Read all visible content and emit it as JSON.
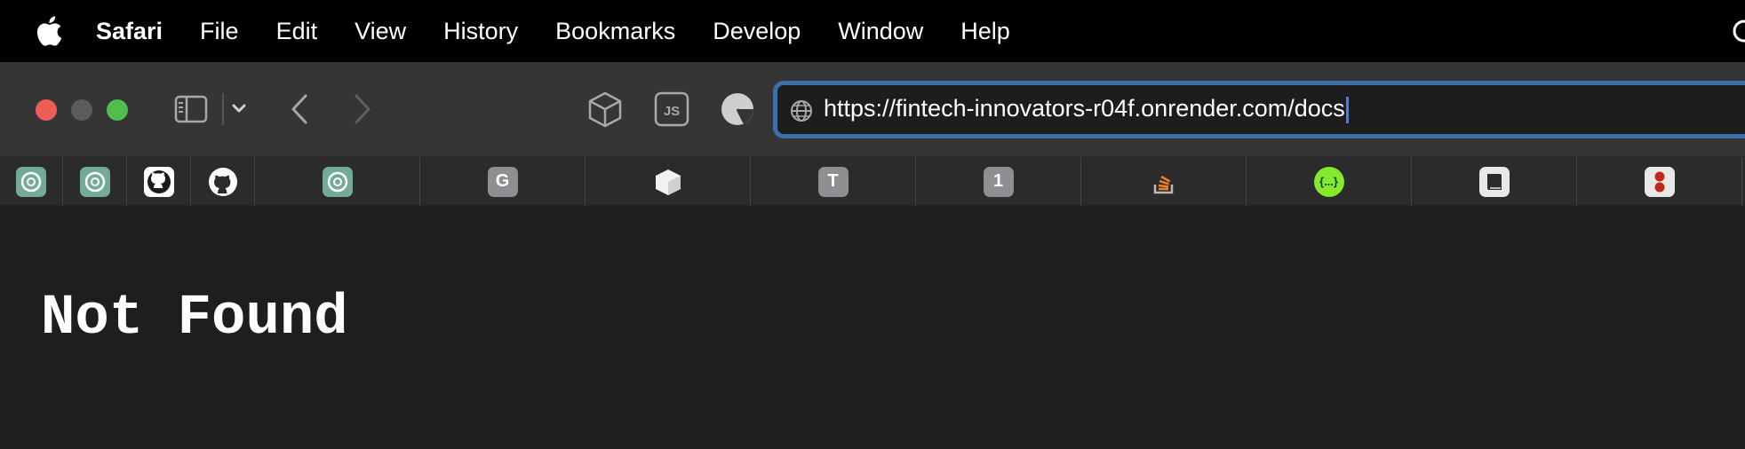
{
  "menubar": {
    "apple_icon": "apple-icon",
    "items": [
      {
        "label": "Safari"
      },
      {
        "label": "File"
      },
      {
        "label": "Edit"
      },
      {
        "label": "View"
      },
      {
        "label": "History"
      },
      {
        "label": "Bookmarks"
      },
      {
        "label": "Develop"
      },
      {
        "label": "Window"
      },
      {
        "label": "Help"
      }
    ]
  },
  "toolbar": {
    "traffic_lights": {
      "close": "#ee5d56",
      "minimize": "#5c5c5c",
      "zoom": "#4fbe4e"
    },
    "icons": [
      "sidebar-icon",
      "chevron-down-icon",
      "back-icon",
      "forward-icon",
      "cube-extension-icon",
      "js-extension-icon",
      "pie-extension-icon"
    ],
    "address": {
      "url": "https://fintech-innovators-r04f.onrender.com/docs",
      "icon": "globe-icon"
    }
  },
  "favorites": [
    {
      "icon": "chatgpt-icon",
      "label": ""
    },
    {
      "icon": "chatgpt-icon",
      "label": ""
    },
    {
      "icon": "github-icon",
      "label": ""
    },
    {
      "icon": "github-icon",
      "label": ""
    },
    {
      "icon": "chatgpt-icon",
      "label": ""
    },
    {
      "icon": "letter-g-icon",
      "label": "G"
    },
    {
      "icon": "white-cube-icon",
      "label": ""
    },
    {
      "icon": "letter-t-icon",
      "label": "T"
    },
    {
      "icon": "number-1-icon",
      "label": "1"
    },
    {
      "icon": "stackoverflow-icon",
      "label": ""
    },
    {
      "icon": "swagger-icon",
      "label": "{...}"
    },
    {
      "icon": "book-icon",
      "label": ""
    },
    {
      "icon": "red-dots-icon",
      "label": ""
    }
  ],
  "page": {
    "heading": "Not Found"
  },
  "colors": {
    "menubar_bg": "#000000",
    "toolbar_bg": "#353535",
    "address_border": "#3e6fa8",
    "content_bg": "#1e1e1e"
  }
}
